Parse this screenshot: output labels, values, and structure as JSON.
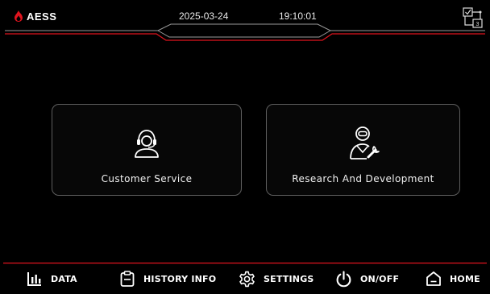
{
  "header": {
    "brand": "AESS",
    "date": "2025-03-24",
    "time": "19:10:01",
    "network_badge": "3"
  },
  "menu": [
    {
      "label": "Customer Service",
      "icon": "headset-agent-icon"
    },
    {
      "label": "Research And Development",
      "icon": "engineer-wrench-icon"
    }
  ],
  "nav": [
    {
      "label": "DATA",
      "icon": "bar-chart-icon"
    },
    {
      "label": "HISTORY INFO",
      "icon": "clipboard-icon"
    },
    {
      "label": "SETTINGS",
      "icon": "gear-icon"
    },
    {
      "label": "ON/OFF",
      "icon": "power-icon"
    },
    {
      "label": "HOME",
      "icon": "home-icon"
    }
  ],
  "colors": {
    "accent": "#e0141e",
    "background": "#000000",
    "card_border": "#5e5e5e"
  }
}
